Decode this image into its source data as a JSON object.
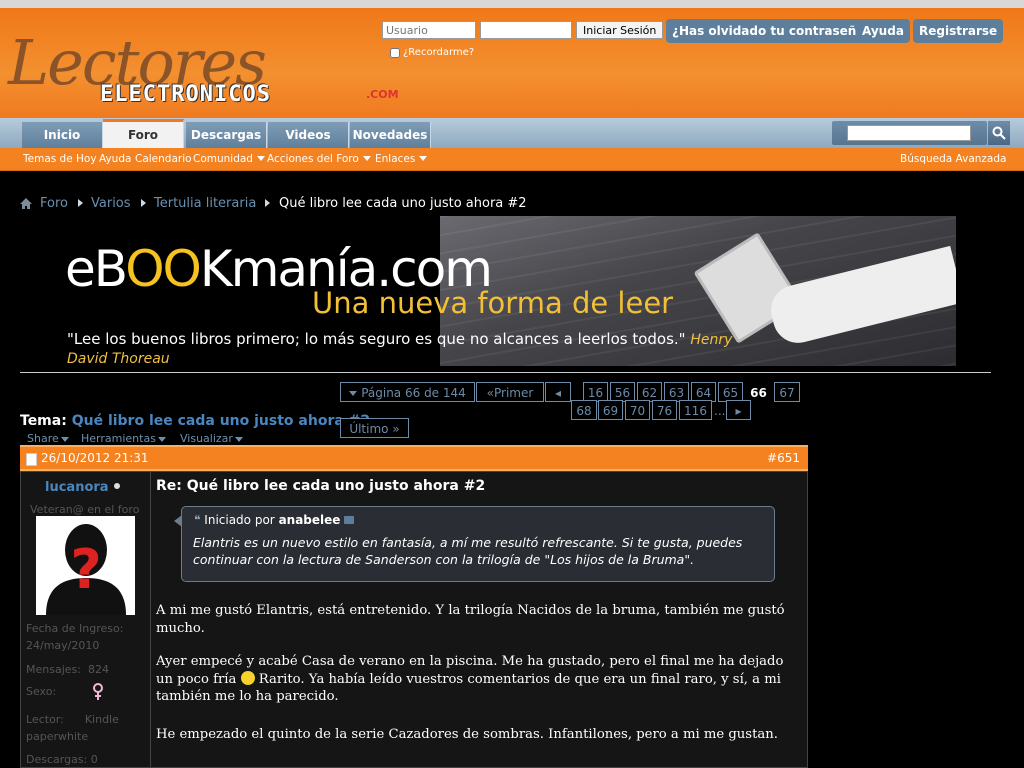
{
  "header": {
    "logo_script": "Lectores",
    "logo_main": "ELECTRONICOS",
    "logo_com": ".COM",
    "login": {
      "username_placeholder": "Usuario",
      "password_placeholder": "",
      "login_button": "Iniciar Sesión",
      "remember_label": "¿Recordarme?"
    },
    "links": {
      "forgot": "¿Has olvidado tu contraseña?",
      "help": "Ayuda",
      "register": "Registrarse"
    }
  },
  "nav": {
    "tabs": [
      "Inicio",
      "Foro",
      "Descargas",
      "Videos",
      "Novedades"
    ],
    "active_tab": "Foro",
    "search_placeholder": ""
  },
  "subnav": {
    "items": [
      "Temas de Hoy",
      "Ayuda",
      "Calendario",
      "Comunidad",
      "Acciones del Foro",
      "Enlaces"
    ],
    "advanced_search": "Búsqueda Avanzada"
  },
  "breadcrumb": [
    "Foro",
    "Varios",
    "Tertulia literaria",
    "Qué libro lee cada uno justo ahora #2"
  ],
  "banner": {
    "logo_pre": "eB",
    "logo_oo": "OO",
    "logo_post": "Kmanía.com",
    "tagline": "Una nueva forma de leer",
    "quote": "\"Lee los buenos libros primero; lo más seguro es que no alcances a leerlos todos.\"",
    "quote_author": "Henry David Thoreau"
  },
  "pagination": {
    "label": "Página 66 de 144",
    "first": "Primer",
    "pages_row1": [
      "16",
      "56",
      "62",
      "63",
      "64",
      "65",
      "66",
      "67"
    ],
    "pages_row2": [
      "68",
      "69",
      "70",
      "76",
      "116"
    ],
    "ellipsis": "...",
    "last": "Último",
    "current": "66"
  },
  "thread": {
    "tema_label": "Tema:",
    "title": "Qué libro lee cada uno justo ahora #2",
    "tools": [
      "Share",
      "Herramientas",
      "Visualizar"
    ]
  },
  "post": {
    "date": "26/10/2012 21:31",
    "number": "#651",
    "user": {
      "name": "lucanora",
      "title": "Veteran@ en el foro",
      "join_label": "Fecha de Ingreso:",
      "join_date": "24/may/2010",
      "posts_label": "Mensajes:",
      "posts": "824",
      "sex_label": "Sexo:",
      "reader_label": "Lector:",
      "reader": "Kindle paperwhite",
      "downloads_label": "Descargas:",
      "downloads": "0"
    },
    "title": "Re: Qué libro lee cada uno justo ahora #2",
    "quote": {
      "started_by": "Iniciado por",
      "author": "anabelee",
      "text": "Elantris es un nuevo estilo en fantasía, a mí me resultó refrescante. Si te gusta, puedes continuar con la lectura de Sanderson con la trilogía de \"Los hijos de la Bruma\"."
    },
    "paragraph1": "A mi me gustó Elantris, está entretenido. Y la trilogía Nacidos de la bruma, también me gustó mucho.",
    "paragraph2_a": "Ayer empecé y acabé Casa de verano en la piscina. Me ha gustado, pero el final me ha dejado un poco fría",
    "paragraph2_b": "Rarito. Ya había leído vuestros comentarios de que era un final raro, y sí, a mi también me lo ha parecido.",
    "paragraph3": "He empezado el quinto de la serie Cazadores de sombras. Infantilones, pero a mi me gustan."
  }
}
